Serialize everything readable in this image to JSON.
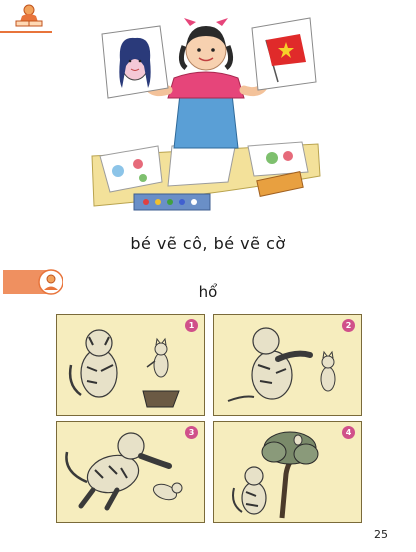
{
  "page": {
    "caption": "bé vẽ cô, bé vẽ cờ",
    "story_title": "hổ",
    "page_number": "25"
  },
  "panels": [
    {
      "number": "1"
    },
    {
      "number": "2"
    },
    {
      "number": "3"
    },
    {
      "number": "4"
    }
  ],
  "icons": {
    "header": "reading-child-icon",
    "section": "storyteller-icon"
  },
  "colors": {
    "accent": "#e8743b",
    "panel_bg": "#f6edbe",
    "panel_number": "#d0508a"
  }
}
